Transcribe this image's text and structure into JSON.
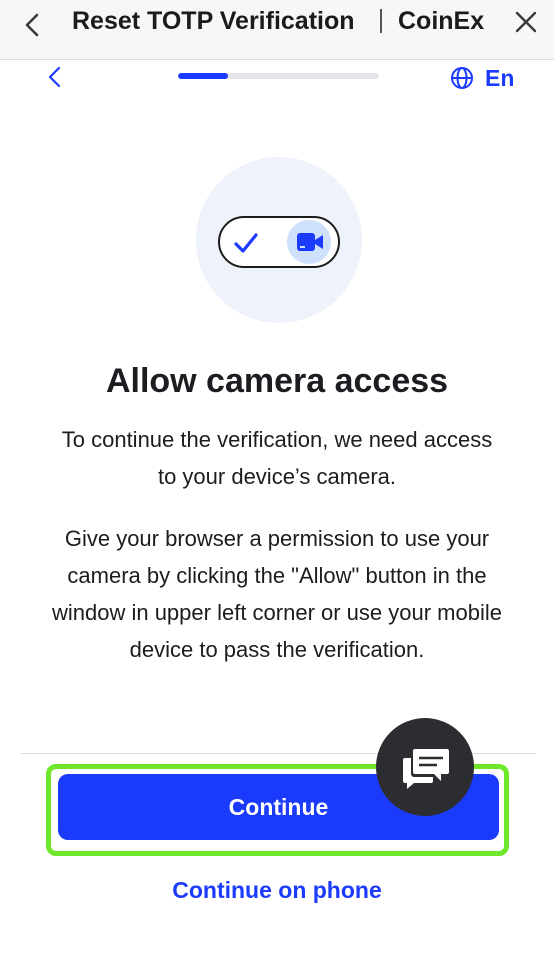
{
  "topbar": {
    "title": "Reset TOTP Verification",
    "brand": "CoinEx"
  },
  "subnav": {
    "progress_fraction": 0.25,
    "language": "En"
  },
  "main": {
    "heading": "Allow camera access",
    "paragraph1": "To continue the verification, we need access to your device’s camera.",
    "paragraph2": "Give your browser a permission to use your camera by clicking the \"Allow\" button in the window in upper left corner or use your mobile device to pass the verification."
  },
  "actions": {
    "continue_label": "Continue",
    "continue_on_phone_label": "Continue on phone"
  },
  "colors": {
    "accent": "#1a3afc",
    "highlight": "#6ee62a",
    "hero_bg": "#eef2fb",
    "chat_fab": "#2c2d30"
  },
  "icons": [
    "back-icon",
    "close-icon",
    "globe-icon",
    "check-icon",
    "camera-icon",
    "chat-icon"
  ]
}
